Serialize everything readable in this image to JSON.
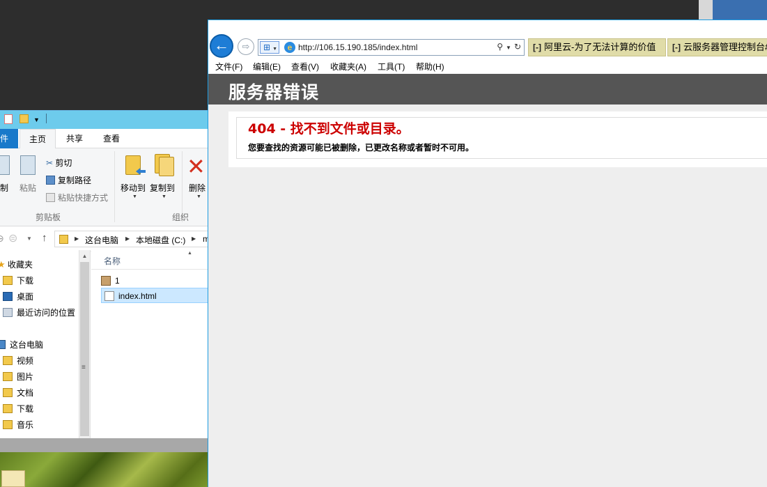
{
  "explorer": {
    "ribbon_tabs": [
      "件",
      "主页",
      "共享",
      "查看"
    ],
    "clipboard": {
      "copy_label": "制",
      "paste_label": "粘贴",
      "cut_label": "剪切",
      "copy_path_label": "复制路径",
      "paste_shortcut_label": "粘贴快捷方式",
      "group_label": "剪贴板"
    },
    "organize": {
      "move_to_label": "移动到",
      "copy_to_label": "复制到",
      "delete_label": "删除",
      "group_label": "组织"
    },
    "breadcrumb": [
      "这台电脑",
      "本地磁盘 (C:)",
      "m"
    ],
    "nav_items": [
      {
        "label": "收藏夹",
        "icon": "star-icon"
      },
      {
        "label": "下载",
        "icon": "downloads-folder-icon"
      },
      {
        "label": "桌面",
        "icon": "desktop-icon"
      },
      {
        "label": "最近访问的位置",
        "icon": "recent-places-icon"
      },
      {
        "label": "这台电脑",
        "icon": "this-pc-icon"
      },
      {
        "label": "视频",
        "icon": "videos-folder-icon"
      },
      {
        "label": "图片",
        "icon": "pictures-folder-icon"
      },
      {
        "label": "文档",
        "icon": "documents-folder-icon"
      },
      {
        "label": "下载",
        "icon": "downloads-folder-icon"
      },
      {
        "label": "音乐",
        "icon": "music-folder-icon"
      }
    ],
    "column_header": "名称",
    "files": [
      {
        "name": "1",
        "icon": "image-file-icon",
        "selected": false
      },
      {
        "name": "index.html",
        "icon": "html-file-icon",
        "selected": true
      }
    ]
  },
  "ie": {
    "url": "http://106.15.190.185/index.html",
    "tabs": [
      "阿里云-为了无法计算的价值",
      "云服务器管理控制台#/"
    ],
    "menu": [
      "文件(F)",
      "编辑(E)",
      "查看(V)",
      "收藏夹(A)",
      "工具(T)",
      "帮助(H)"
    ],
    "page": {
      "header": "服务器错误",
      "error_title": "404 - 找不到文件或目录。",
      "error_message": "您要查找的资源可能已被删除，已更改名称或者暂时不可用。"
    }
  },
  "colors": {
    "explorer_titlebar": "#6dcbec",
    "file_tab": "#1979ca",
    "error_header_bg": "#555555",
    "error_title_color": "#cc0000",
    "ie_tab_bg": "#e0dca8"
  }
}
